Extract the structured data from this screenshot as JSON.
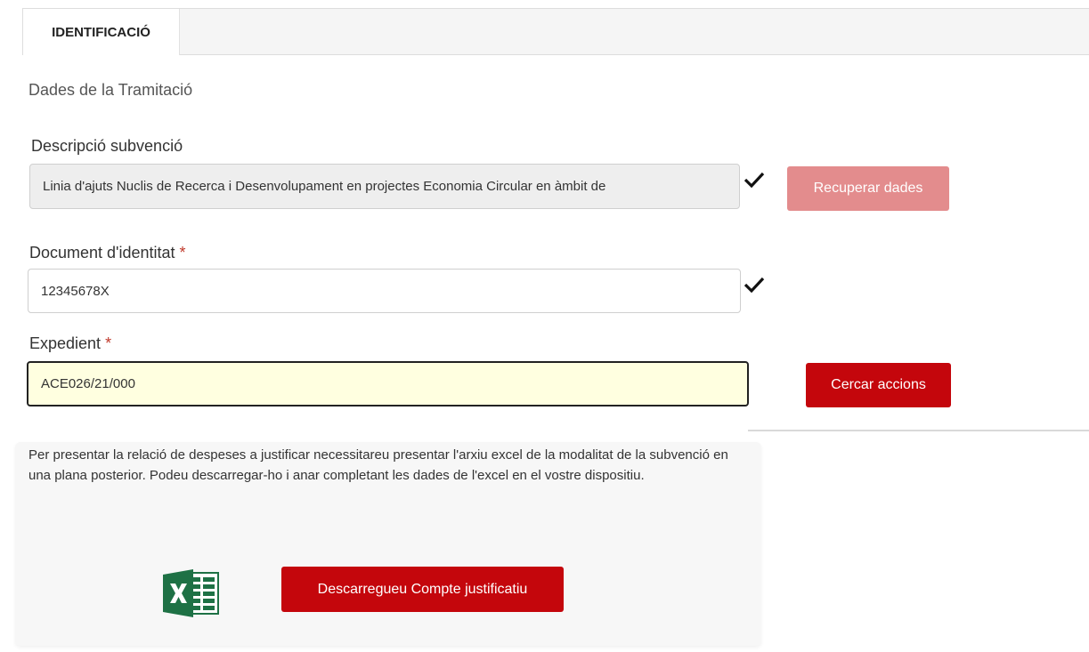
{
  "tabs": [
    {
      "label": "IDENTIFICACIÓ"
    }
  ],
  "section_title": "Dades de la Tramitació",
  "descripcio": {
    "label": "Descripció subvenció",
    "value": "Linia d'ajuts Nuclis de Recerca i Desenvolupament en projectes Economia Circular en àmbit de"
  },
  "recuperar_button": "Recuperar dades",
  "document": {
    "label": "Document d'identitat",
    "required_mark": "*",
    "value": "12345678X"
  },
  "expedient": {
    "label": "Expedient",
    "required_mark": "*",
    "value": "ACE026/21/000"
  },
  "cercar_button": "Cercar accions",
  "info_text": "Per presentar la relació de despeses a justificar necessitareu presentar l'arxiu excel de la modalitat de la subvenció en una plana posterior. Podeu descarregar-ho i anar completant les dades de l'excel en el vostre dispositiu.",
  "download_button": "Descarregueu Compte justificatiu",
  "icons": {
    "check": "check-icon",
    "excel": "excel-icon"
  },
  "colors": {
    "primary_button": "#c4060c",
    "disabled_button": "#e38c8d",
    "active_field_bg": "#ffffe0",
    "excel_green": "#1e7145"
  }
}
